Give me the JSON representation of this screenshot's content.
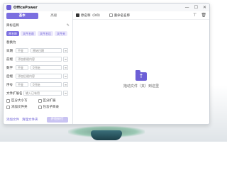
{
  "app": {
    "title": "OfficePower"
  },
  "window_controls": [
    "—",
    "☐",
    "✕"
  ],
  "tabs": [
    {
      "label": "基本",
      "active": true
    },
    {
      "label": "高级",
      "active": false
    }
  ],
  "left": {
    "section_title": "目标名称",
    "pills": [
      {
        "label": "原名称",
        "selected": true
      },
      {
        "label": "文件名前",
        "selected": false
      },
      {
        "label": "文件名后",
        "selected": false
      },
      {
        "label": "文件夹",
        "selected": false
      }
    ],
    "replace_label": "替换为",
    "rows": [
      {
        "label": "日期",
        "fields": [
          "不变",
          "原始日期"
        ]
      },
      {
        "label": "前缀",
        "fields": [
          "添加前缀内容"
        ]
      },
      {
        "label": "数字",
        "fields": [
          "不变",
          "0开始"
        ]
      },
      {
        "label": "后缀",
        "fields": [
          "添加后缀内容"
        ]
      },
      {
        "label": "序号",
        "fields": [
          "不变",
          "0开始"
        ]
      }
    ],
    "ext_row": {
      "label": "文件扩展名",
      "placeholder": "输入已有用"
    },
    "checks": [
      "区分大小写",
      "区分扩展",
      "添加文件夹",
      "包含子目录"
    ],
    "actions": {
      "link1": "添加文件",
      "link2": "清理文件夹",
      "run": "开始执行"
    }
  },
  "right": {
    "toolbar": {
      "check1": "原名称（0/0）",
      "check2": "重命名名称"
    },
    "dropzone_text": "拖动文件（夹）到这里"
  },
  "colors": {
    "accent": "#7b6fe0",
    "accent_light": "#ebe8fb"
  }
}
